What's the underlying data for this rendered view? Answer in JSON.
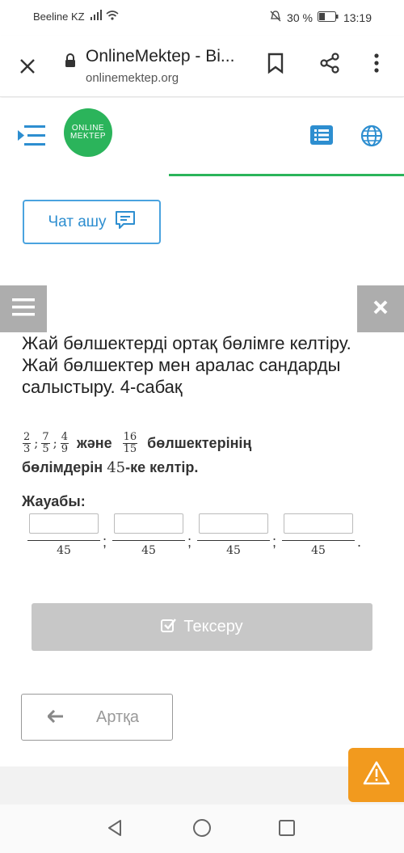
{
  "status_bar": {
    "carrier": "Beeline KZ",
    "battery": "30 %",
    "time": "13:19"
  },
  "browser": {
    "title": "OnlineMektep - Bi...",
    "url": "onlinemektep.org"
  },
  "site": {
    "logo_line1": "ONLINE",
    "logo_line2": "MEKTEP",
    "accent": "#2bb45b"
  },
  "chat_button": {
    "label": "Чат ашу"
  },
  "lesson": {
    "title": "Жай бөлшектерді ортақ бөлімге келтіру. Жай бөлшектер мен аралас сандарды салыстыру. 4-сабақ"
  },
  "task": {
    "fractions": [
      {
        "num": "2",
        "den": "3"
      },
      {
        "num": "7",
        "den": "5"
      },
      {
        "num": "4",
        "den": "9"
      }
    ],
    "sep": ";",
    "and": "және",
    "last_fraction": {
      "num": "16",
      "den": "15"
    },
    "text1": "бөлшектерінің",
    "text2_pre": "бөлімдерін",
    "target": "45",
    "text2_post": "-ке келтір."
  },
  "answer": {
    "label": "Жауабы:",
    "denominators": [
      "45",
      "45",
      "45",
      "45"
    ],
    "separator": ";",
    "end": "."
  },
  "check_button": {
    "label": "Тексеру"
  },
  "back_button": {
    "label": "Артқа"
  }
}
